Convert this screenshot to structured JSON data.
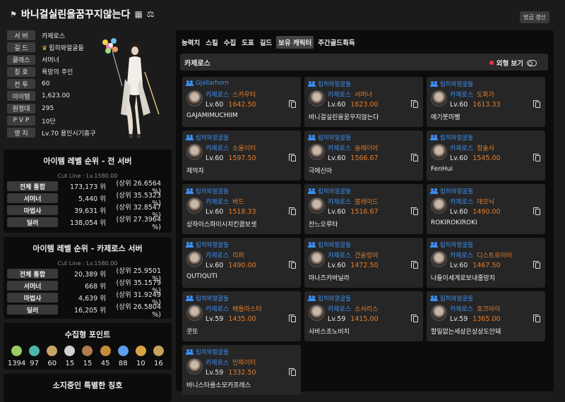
{
  "header": {
    "title": "바니걸실린을꿈꾸지않는다",
    "refresh_label": "방금 갱신"
  },
  "profile": {
    "rows": [
      {
        "label": "서 버",
        "value": "카제로스"
      },
      {
        "label": "길 드",
        "value": "립히와얼굴들"
      },
      {
        "label": "클래스",
        "value": "서머너"
      },
      {
        "label": "칭 호",
        "value": "욕망의 주인"
      },
      {
        "label": "전 투",
        "value": "60"
      },
      {
        "label": "아이템",
        "value": "1,623.00"
      },
      {
        "label": "원정대",
        "value": "295"
      },
      {
        "label": "P V P",
        "value": "10단"
      },
      {
        "label": "영 지",
        "value": "Lv.70 용인시기흥구"
      }
    ]
  },
  "rank_all": {
    "title": "아이템 레벨 순위 - 전 서버",
    "cutline": "Cut Line : Lv.1580.00",
    "rows": [
      {
        "label": "전체 통합",
        "value": "173,173 위",
        "sub": "(상위 26.6564 %)"
      },
      {
        "label": "서머너",
        "value": "5,440 위",
        "sub": "(상위 35.5323 %)"
      },
      {
        "label": "마법사",
        "value": "39,631 위",
        "sub": "(상위 32.8547 %)"
      },
      {
        "label": "딜러",
        "value": "138,054 위",
        "sub": "(상위 27.3964 %)"
      }
    ]
  },
  "rank_server": {
    "title": "아이템 레벨 순위 - 카제로스 서버",
    "cutline": "Cut Line : Lv.1580.00",
    "rows": [
      {
        "label": "전체 통합",
        "value": "20,389 위",
        "sub": "(상위 25.9501 %)"
      },
      {
        "label": "서머너",
        "value": "668 위",
        "sub": "(상위 35.1579 %)"
      },
      {
        "label": "마법사",
        "value": "4,639 위",
        "sub": "(상위 31.9249 %)"
      },
      {
        "label": "딜러",
        "value": "16,205 위",
        "sub": "(상위 26.5804 %)"
      }
    ]
  },
  "collection": {
    "title": "수집형 포인트",
    "items": [
      {
        "icon": "island-heart-icon",
        "value": "1394",
        "color": "#9ccc65"
      },
      {
        "icon": "orb-icon",
        "value": "97",
        "color": "#4db6ac"
      },
      {
        "icon": "map-icon",
        "value": "60",
        "color": "#c9a46a"
      },
      {
        "icon": "feather-icon",
        "value": "15",
        "color": "#d0d0d0"
      },
      {
        "icon": "mask-icon",
        "value": "15",
        "color": "#b07a4a"
      },
      {
        "icon": "brush-icon",
        "value": "45",
        "color": "#c28b3a"
      },
      {
        "icon": "leaf-icon",
        "value": "88",
        "color": "#5c9ded"
      },
      {
        "icon": "star-icon",
        "value": "10",
        "color": "#d9a441"
      },
      {
        "icon": "seed-icon",
        "value": "16",
        "color": "#c8a060"
      }
    ]
  },
  "special_title": "소지중인 특별한 칭호",
  "tabs": [
    "능력치",
    "스킬",
    "수집",
    "도표",
    "길드",
    "보유 캐릭터",
    "주간골드획득"
  ],
  "server_bar": {
    "name": "카제로스",
    "outfit_label": "외형 보기"
  },
  "characters": [
    {
      "guild": "Gjallarhorn",
      "server": "카제로스",
      "class": "스카우터",
      "level": "Lv.60",
      "ilvl": "1642.50",
      "name": "GAJAMIMUCHIIM"
    },
    {
      "guild": "립히와얼굴들",
      "server": "카제로스",
      "class": "서머너",
      "level": "Lv.60",
      "ilvl": "1623.00",
      "name": "바니걸실린을꿈꾸지않는다"
    },
    {
      "guild": "립히와얼굴들",
      "server": "카제로스",
      "class": "도화가",
      "level": "Lv.60",
      "ilvl": "1613.33",
      "name": "애기붓미쨍"
    },
    {
      "guild": "립히와얼굴들",
      "server": "카제로스",
      "class": "소울이터",
      "level": "Lv.60",
      "ilvl": "1597.50",
      "name": "제억자"
    },
    {
      "guild": "립히와얼굴들",
      "server": "카제로스",
      "class": "슬레이어",
      "level": "Lv.60",
      "ilvl": "1566.67",
      "name": "극에신아"
    },
    {
      "guild": "립히와얼굴들",
      "server": "카제로스",
      "class": "창술사",
      "level": "Lv.60",
      "ilvl": "1545.00",
      "name": "FenHui"
    },
    {
      "guild": "립히와얼굴들",
      "server": "카제로스",
      "class": "바드",
      "level": "Lv.60",
      "ilvl": "1518.33",
      "name": "상하이스파이시치킨콤보셋"
    },
    {
      "guild": "립히와얼굴들",
      "server": "카제로스",
      "class": "블레이드",
      "level": "Lv.60",
      "ilvl": "1516.67",
      "name": "잔느오루타"
    },
    {
      "guild": "립히와얼굴들",
      "server": "카제로스",
      "class": "데모닉",
      "level": "Lv.60",
      "ilvl": "1490.00",
      "name": "ROKIROKIROKI"
    },
    {
      "guild": "립히와얼굴들",
      "server": "카제로스",
      "class": "리퍼",
      "level": "Lv.60",
      "ilvl": "1490.00",
      "name": "QUTIQUTI"
    },
    {
      "guild": "립히와얼굴들",
      "server": "카제로스",
      "class": "건슬링어",
      "level": "Lv.60",
      "ilvl": "1472.50",
      "name": "마나즈카바닐라"
    },
    {
      "guild": "립히와얼굴들",
      "server": "카제로스",
      "class": "디스트로이어",
      "level": "Lv.60",
      "ilvl": "1467.50",
      "name": "나들이세계로보내줄망치"
    },
    {
      "guild": "립히와얼굴들",
      "server": "카제로스",
      "class": "배틀마스터",
      "level": "Lv.59",
      "ilvl": "1435.00",
      "name": "쿳또"
    },
    {
      "guild": "립히와얼굴들",
      "server": "카제로스",
      "class": "소서리스",
      "level": "Lv.59",
      "ilvl": "1415.00",
      "name": "사바스조노비치"
    },
    {
      "guild": "립히와얼굴들",
      "server": "카제로스",
      "class": "호크아이",
      "level": "Lv.59",
      "ilvl": "1365.00",
      "name": "할일없는세상은상상도안돼"
    },
    {
      "guild": "립히와얼굴들",
      "server": "카제로스",
      "class": "인파이터",
      "level": "Lv.59",
      "ilvl": "1332.50",
      "name": "바니스타를소모카프레스"
    }
  ]
}
